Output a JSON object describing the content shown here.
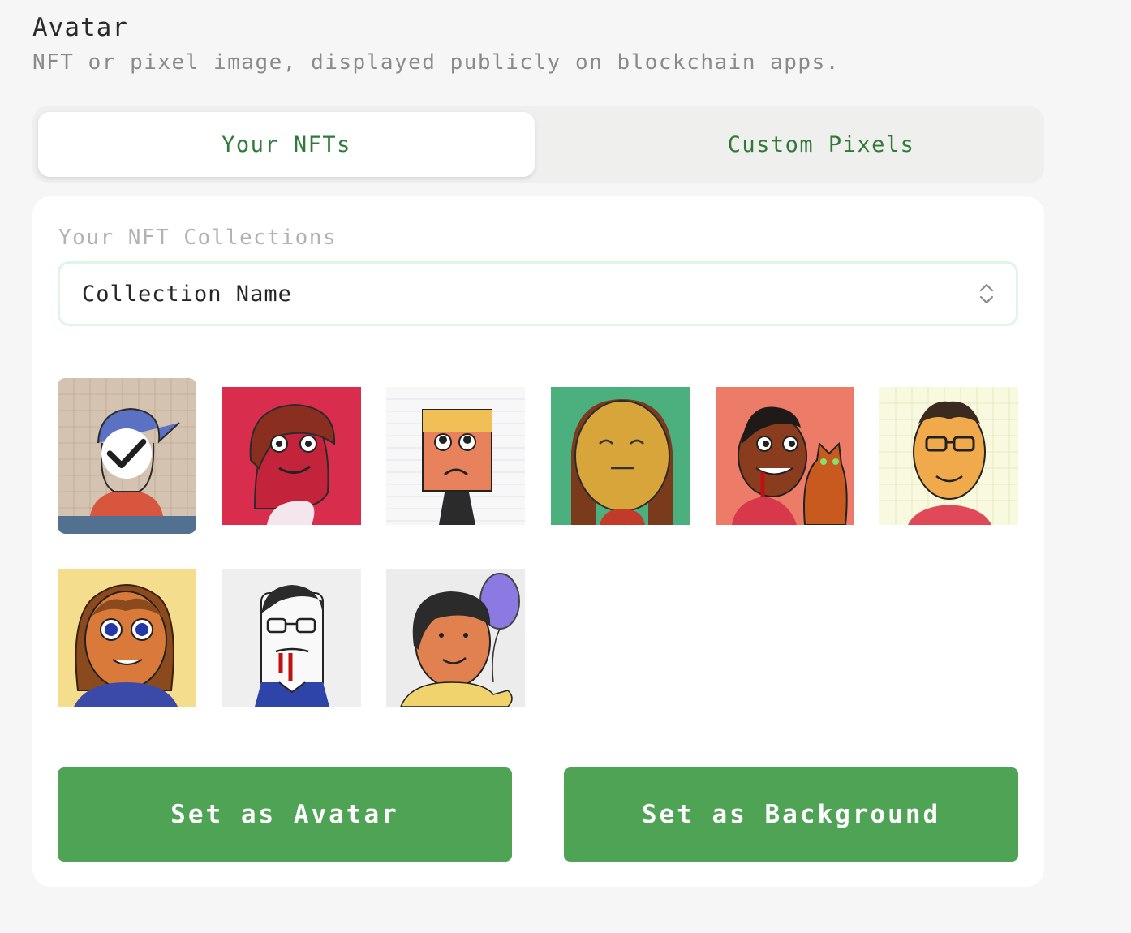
{
  "header": {
    "title": "Avatar",
    "subtitle": "NFT or pixel image, displayed publicly on blockchain apps."
  },
  "tabs": [
    {
      "label": "Your NFTs",
      "active": true
    },
    {
      "label": "Custom Pixels",
      "active": false
    }
  ],
  "collections": {
    "label": "Your NFT Collections",
    "selected": "Collection Name"
  },
  "nfts": [
    {
      "icon": "avatar-cap-kid",
      "bg": "#d5c3b1",
      "selected": true
    },
    {
      "icon": "avatar-red-smile",
      "bg": "#d82d4c",
      "selected": false
    },
    {
      "icon": "avatar-square-head",
      "bg": "#f7f7f7",
      "selected": false
    },
    {
      "icon": "avatar-long-hair",
      "bg": "#4caf7e",
      "selected": false
    },
    {
      "icon": "avatar-vampire-cat",
      "bg": "#ec7b68",
      "selected": false
    },
    {
      "icon": "avatar-glasses",
      "bg": "#f8f9df",
      "selected": false
    },
    {
      "icon": "avatar-curly-hair",
      "bg": "#f4de8e",
      "selected": false
    },
    {
      "icon": "avatar-vampire-glasses",
      "bg": "#efefef",
      "selected": false
    },
    {
      "icon": "avatar-balloon",
      "bg": "#ececec",
      "selected": false
    }
  ],
  "actions": {
    "set_avatar": "Set as Avatar",
    "set_background": "Set as Background"
  },
  "colors": {
    "accent": "#4ea354",
    "tab_text": "#2f7a3a",
    "selection": "#52708f"
  }
}
